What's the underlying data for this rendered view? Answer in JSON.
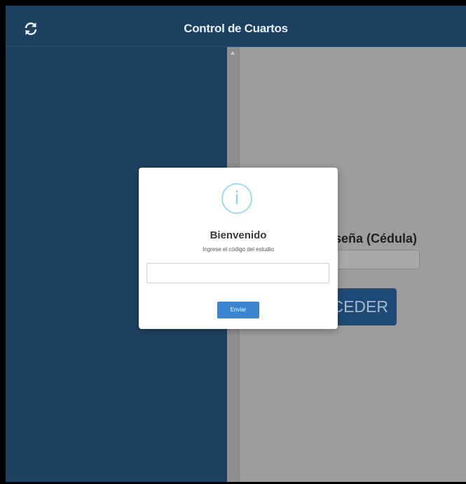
{
  "header": {
    "title": "Control de Cuartos",
    "refresh_icon": "refresh-icon"
  },
  "background_form": {
    "label_partial": "seña (Cédula)",
    "button_partial": "CEDER"
  },
  "modal": {
    "icon": "info-icon",
    "icon_glyph": "i",
    "title": "Bienvenido",
    "subtitle": "Ingrese el código del estudio",
    "input_value": "",
    "input_placeholder": "",
    "submit_label": "Enviar"
  },
  "colors": {
    "header_bg": "#1e4060",
    "sidebar_bg": "#1e4060",
    "content_bg_dimmed": "#9d9d9d",
    "info_icon": "#9fdcf0",
    "primary_button": "#3a84d0"
  }
}
